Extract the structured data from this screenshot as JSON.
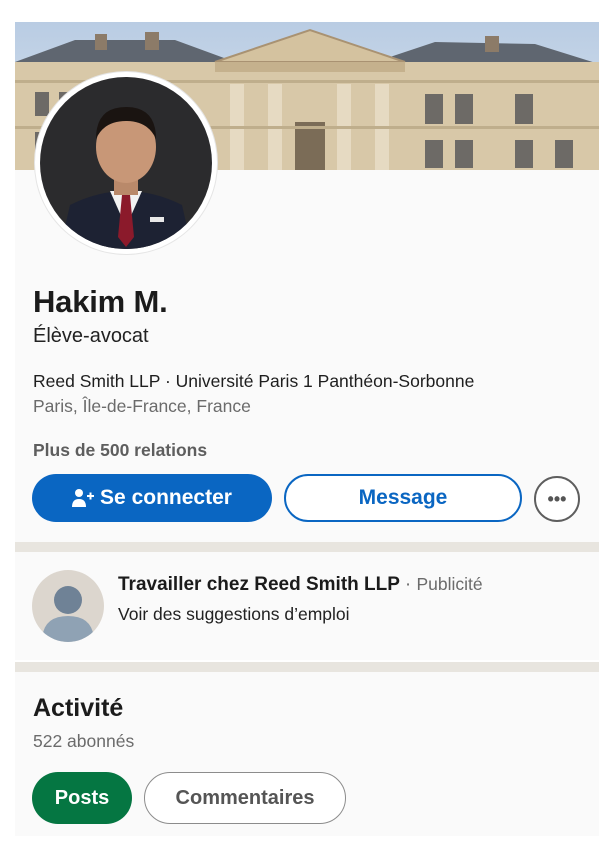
{
  "profile": {
    "name": "Hakim M.",
    "headline": "Élève-avocat",
    "organizations": "Reed Smith LLP · Université Paris 1 Panthéon-Sorbonne",
    "location": "Paris, Île-de-France, France",
    "connections": "Plus de 500 relations"
  },
  "actions": {
    "connect_label": "Se connecter",
    "connect_icon": "add-person-icon",
    "message_label": "Message",
    "more_label": "•••"
  },
  "ad": {
    "title": "Travailler chez Reed Smith LLP",
    "separator": "·",
    "tag": "Publicité",
    "subtitle": "Voir des suggestions d’emploi"
  },
  "activity": {
    "title": "Activité",
    "followers": "522 abonnés",
    "tabs": [
      {
        "label": "Posts",
        "selected": true
      },
      {
        "label": "Commentaires",
        "selected": false
      }
    ]
  },
  "colors": {
    "primary": "#0a66c2",
    "selected_tab": "#057642",
    "divider": "#e8e5df"
  }
}
